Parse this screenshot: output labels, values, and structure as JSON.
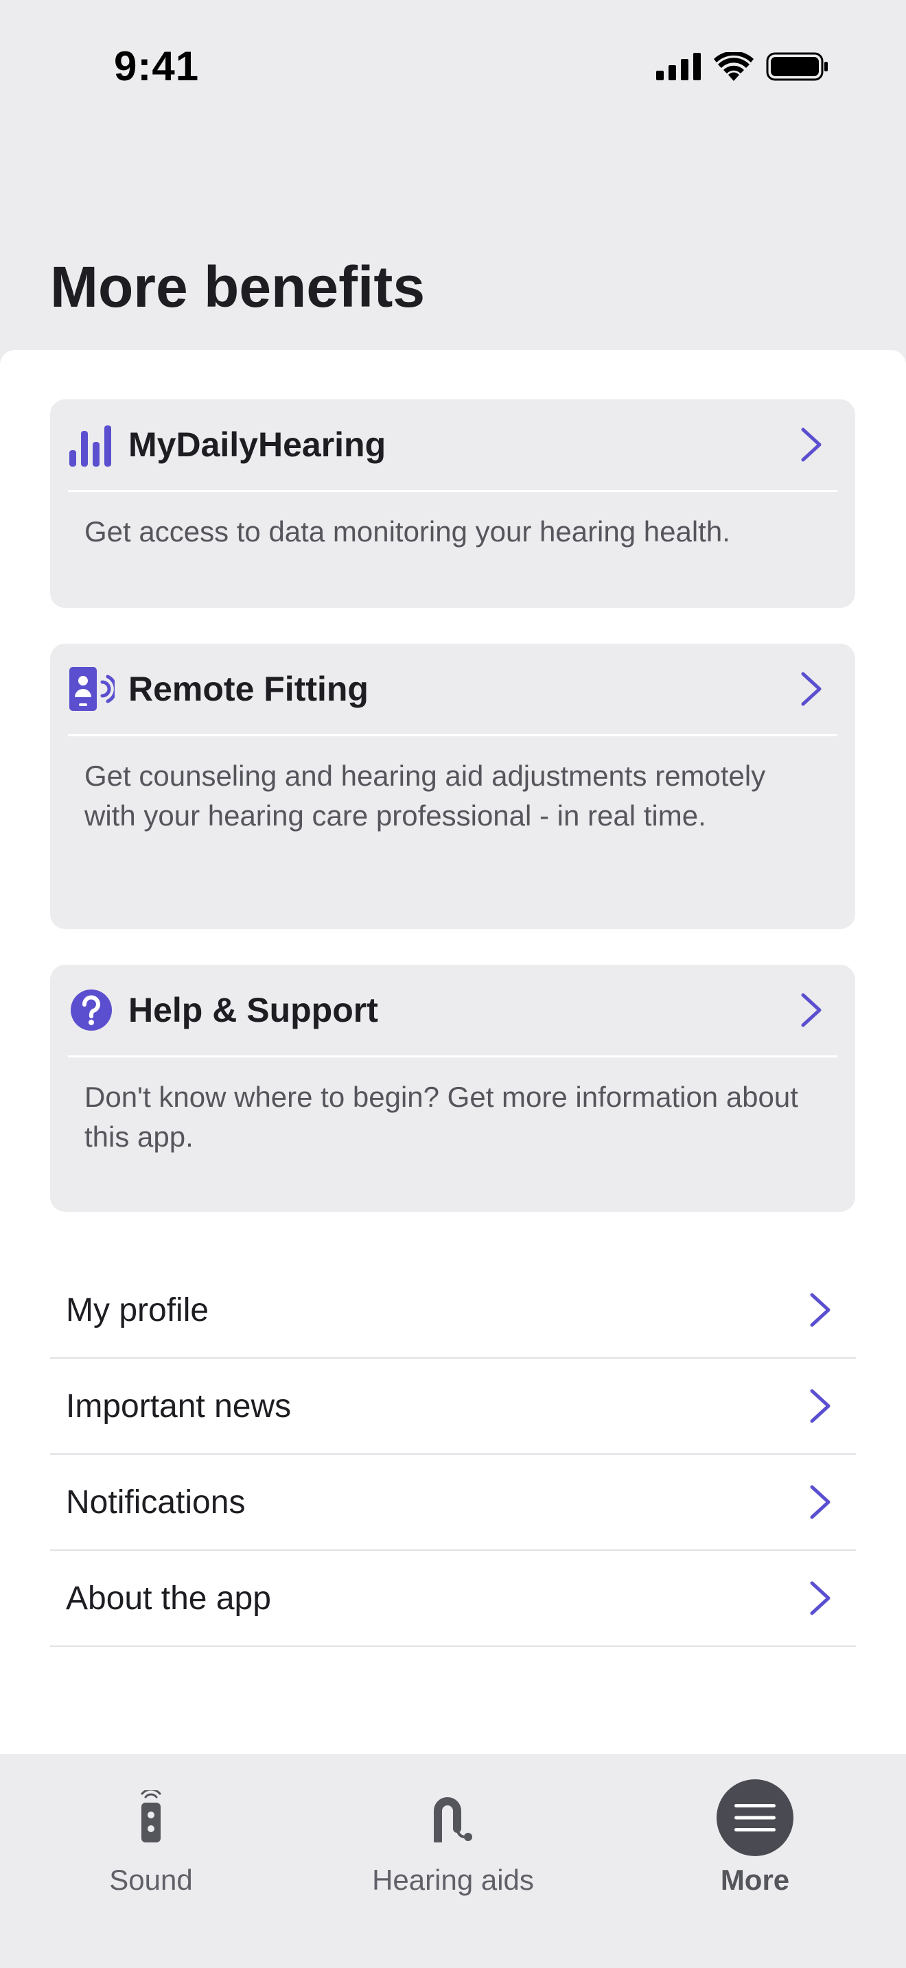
{
  "status_bar": {
    "time": "9:41"
  },
  "page": {
    "title": "More benefits"
  },
  "cards": [
    {
      "icon": "bar-chart-icon",
      "title": "MyDailyHearing",
      "description": "Get access to data monitoring your hearing health."
    },
    {
      "icon": "remote-fitting-icon",
      "title": "Remote Fitting",
      "description": "Get counseling and hearing aid adjustments remotely with your hearing care professional - in real time."
    },
    {
      "icon": "help-circle-icon",
      "title": "Help & Support",
      "description": "Don't know where to begin? Get more information about this app."
    }
  ],
  "menu": [
    {
      "label": "My profile"
    },
    {
      "label": "Important news"
    },
    {
      "label": "Notifications"
    },
    {
      "label": "About the app"
    }
  ],
  "tabbar": {
    "items": [
      {
        "label": "Sound",
        "icon": "remote-control-icon",
        "active": false
      },
      {
        "label": "Hearing aids",
        "icon": "hearing-aid-icon",
        "active": false
      },
      {
        "label": "More",
        "icon": "hamburger-menu-icon",
        "active": true
      }
    ]
  },
  "colors": {
    "accent": "#5b4fcf",
    "background": "#ececee",
    "sheet": "#ffffff",
    "text": "#1d1d22",
    "muted_text": "#55555c"
  }
}
